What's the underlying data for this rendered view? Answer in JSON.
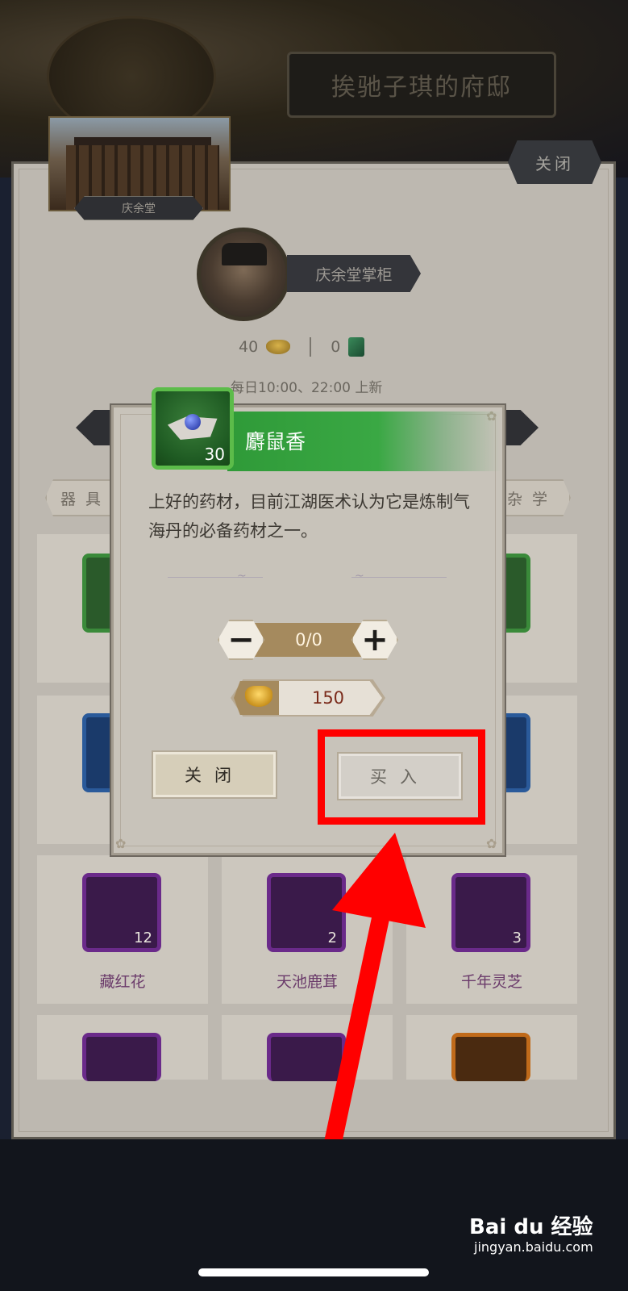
{
  "background": {
    "mansion_title": "挨驰子琪的府邸",
    "shop_name": "庆余堂",
    "close_label": "关闭",
    "keeper_name": "庆余堂掌柜",
    "gold_count": "40",
    "jade_count": "0",
    "refresh_note": "每日10:00、22:00 上新",
    "category_left": "器具",
    "category_right": "杂学",
    "grid_items": [
      {
        "name": "藏红花",
        "qty": "12",
        "rarity_color": "#6a2a8a"
      },
      {
        "name": "天池鹿茸",
        "qty": "2",
        "rarity_color": "#6a2a8a"
      },
      {
        "name": "千年灵芝",
        "qty": "3",
        "rarity_color": "#6a2a8a"
      }
    ]
  },
  "dialog": {
    "item_name": "麝鼠香",
    "item_qty": "30",
    "description": "上好的药材，目前江湖医术认为它是炼制气海丹的必备药材之一。",
    "quantity_display": "0/0",
    "minus_label": "−",
    "plus_label": "+",
    "price": "150",
    "close_button": "关闭",
    "buy_button": "买入"
  },
  "watermark": {
    "brand": "Bai du 经验",
    "url": "jingyan.baidu.com"
  },
  "colors": {
    "highlight": "#ff0000",
    "title_green": "#2f9a38"
  }
}
